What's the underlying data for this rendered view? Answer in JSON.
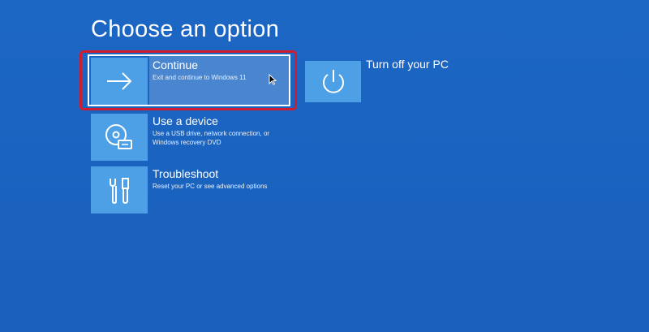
{
  "page": {
    "title": "Choose an option"
  },
  "options": {
    "continue": {
      "label": "Continue",
      "description": "Exit and continue to Windows 11",
      "icon": "arrow-right-icon"
    },
    "use_device": {
      "label": "Use a device",
      "description": "Use a USB drive, network connection, or Windows recovery DVD",
      "icon": "disc-usb-icon"
    },
    "troubleshoot": {
      "label": "Troubleshoot",
      "description": "Reset your PC or see advanced options",
      "icon": "tools-icon"
    },
    "turn_off": {
      "label": "Turn off your PC",
      "icon": "power-icon"
    }
  },
  "colors": {
    "background": "#1b63c0",
    "tile": "#4ea0e6",
    "focus_ring": "#d11b2f"
  }
}
